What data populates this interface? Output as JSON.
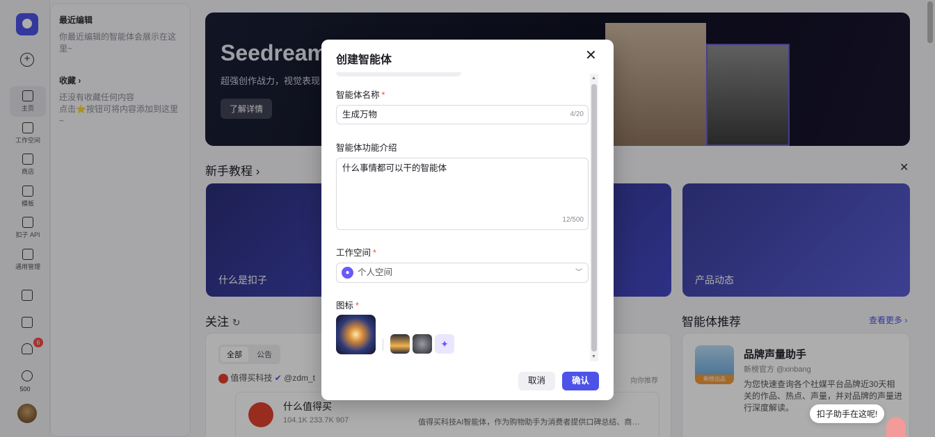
{
  "sidebar": {
    "items": [
      {
        "label": "主页"
      },
      {
        "label": "工作空间"
      },
      {
        "label": "商店"
      },
      {
        "label": "模板"
      },
      {
        "label": "扣子 API"
      },
      {
        "label": "通用管理"
      }
    ],
    "notification_count": "6",
    "points": "500"
  },
  "panel": {
    "recent_title": "最近编辑",
    "recent_empty": "你最近编辑的智能体会展示在这里~",
    "favorites_title": "收藏 ›",
    "favorites_empty_1": "还没有收藏任何内容",
    "favorites_empty_2": "点击⭐按钮可将内容添加到这里~"
  },
  "banner": {
    "title": "Seedream",
    "subtitle": "超强创作战力，视觉表现",
    "button": "了解详情"
  },
  "tutorial": {
    "title": "新手教程  ›",
    "cards": [
      {
        "label": "什么是扣子"
      },
      {
        "label": "产品动态"
      }
    ]
  },
  "follow": {
    "title": "关注",
    "tabs": [
      "全部",
      "公告"
    ],
    "post_author": "值得买科技",
    "post_handle": "@zdm_t",
    "post_tag": "向你推荐",
    "item_name": "什么值得买",
    "item_stats": "104.1K   233.7K   907",
    "item_desc": "值得买科技AI智能体，作为购物助手为消费者提供口碑总结、商…"
  },
  "recommend": {
    "title": "智能体推荐",
    "more": "查看更多 ›",
    "agent_name": "品牌声量助手",
    "agent_meta": "新榜官方  @xinbang",
    "agent_desc": "为您快速查询各个社媒平台品牌近30天相关的作品、热点、声量，并对品牌的声量进行深度解读。",
    "thumb_label": "新榜出品"
  },
  "modal": {
    "title": "创建智能体",
    "name_label": "智能体名称",
    "name_value": "生成万物",
    "name_count": "4/20",
    "desc_label": "智能体功能介绍",
    "desc_value": "什么事情都可以干的智能体",
    "desc_count": "12/500",
    "workspace_label": "工作空间",
    "workspace_value": "个人空间",
    "icon_label": "图标",
    "cancel": "取消",
    "confirm": "确认"
  },
  "assistant_toast": "扣子助手在这呢!",
  "colors": {
    "accent": "#4d53e8",
    "required": "#f54a45",
    "workspace_icon": "#6a5af9"
  }
}
